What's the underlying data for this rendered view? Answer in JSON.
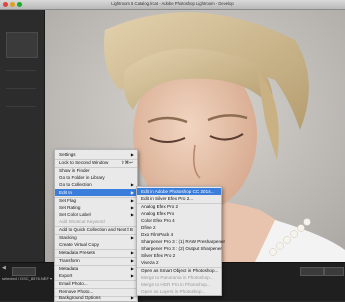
{
  "window": {
    "title": "Lightroom 5 Catalog.lrcat - Adobe Photoshop Lightroom - Develop"
  },
  "filmstrip": {
    "filename_label": "selected / DSC_8576.NEF ▾"
  },
  "context_menu": {
    "items": [
      {
        "label": "Settings",
        "arrow": true
      },
      {
        "label": "Lock to Second Window",
        "shortcut": "⇧⌘↩"
      },
      {
        "label": "Show in Finder"
      },
      {
        "label": "Go to Folder in Library"
      },
      {
        "label": "Go to Collection",
        "arrow": true
      },
      {
        "label": "Edit In",
        "arrow": true,
        "selected": true
      },
      {
        "label": "Set Flag",
        "arrow": true
      },
      {
        "label": "Set Rating",
        "arrow": true
      },
      {
        "label": "Set Color Label",
        "arrow": true
      },
      {
        "label": "Add Shortcut Keyword",
        "disabled": true
      },
      {
        "label": "Add to Quick Collection and Next",
        "shortcut": "⇧B"
      },
      {
        "label": "Stacking",
        "arrow": true
      },
      {
        "label": "Create Virtual Copy"
      },
      {
        "label": "Metadata Presets",
        "arrow": true
      },
      {
        "label": "Transform",
        "arrow": true
      },
      {
        "label": "Metadata",
        "arrow": true
      },
      {
        "label": "Export",
        "arrow": true
      },
      {
        "label": "Email Photo..."
      },
      {
        "label": "Remove Photo..."
      },
      {
        "label": "Background Options",
        "arrow": true
      }
    ]
  },
  "edit_in_submenu": {
    "items": [
      {
        "label": "Edit in Adobe Photoshop CC 2014...",
        "selected": true
      },
      {
        "label": "Edit in Silver Efex Pro 2..."
      },
      {
        "label": "Analog Efex Pro 2"
      },
      {
        "label": "Analog Efex Pro"
      },
      {
        "label": "Color Efex Pro 4"
      },
      {
        "label": "Dfine 2"
      },
      {
        "label": "Dxo FilmPack 4"
      },
      {
        "label": "Sharpener Pro 3 : (1) RAW Presharpener"
      },
      {
        "label": "Sharpener Pro 3 : (2) Output Sharpener"
      },
      {
        "label": "Silver Efex Pro 2"
      },
      {
        "label": "Viveza 2"
      },
      {
        "label": "Open as Smart Object in Photoshop..."
      },
      {
        "label": "Merge to Panorama in Photoshop...",
        "disabled": true
      },
      {
        "label": "Merge to HDR Pro in Photoshop...",
        "disabled": true
      },
      {
        "label": "Open as Layers in Photoshop...",
        "disabled": true
      }
    ]
  },
  "colors": {
    "highlight": "#3a7ddb",
    "menu_bg": "#e9e9e9"
  }
}
